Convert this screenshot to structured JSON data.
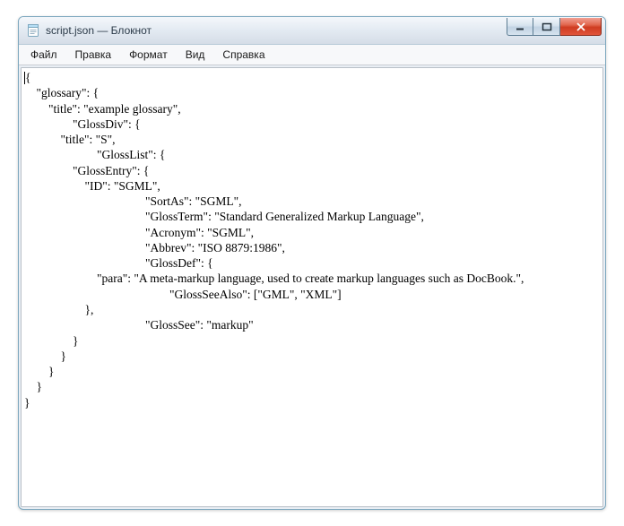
{
  "window": {
    "title": "script.json — Блокнот"
  },
  "menu": {
    "file": "Файл",
    "edit": "Правка",
    "format": "Формат",
    "view": "Вид",
    "help": "Справка"
  },
  "editor": {
    "content": "{\n    \"glossary\": {\n        \"title\": \"example glossary\",\n\t\t\"GlossDiv\": {\n            \"title\": \"S\",\n\t\t\t\"GlossList\": {\n                \"GlossEntry\": {\n                    \"ID\": \"SGML\",\n\t\t\t\t\t\"SortAs\": \"SGML\",\n\t\t\t\t\t\"GlossTerm\": \"Standard Generalized Markup Language\",\n\t\t\t\t\t\"Acronym\": \"SGML\",\n\t\t\t\t\t\"Abbrev\": \"ISO 8879:1986\",\n\t\t\t\t\t\"GlossDef\": {\n                        \"para\": \"A meta-markup language, used to create markup languages such as DocBook.\",\n\t\t\t\t\t\t\"GlossSeeAlso\": [\"GML\", \"XML\"]\n                    },\n\t\t\t\t\t\"GlossSee\": \"markup\"\n                }\n            }\n        }\n    }\n}"
  }
}
